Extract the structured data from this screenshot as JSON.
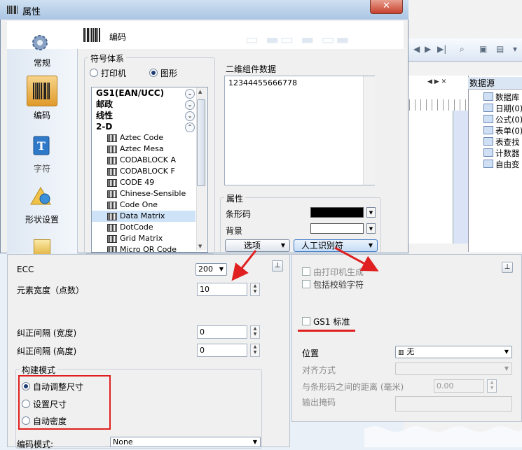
{
  "window": {
    "title": "属性",
    "close": "✕"
  },
  "category_title": "编码",
  "sidebar": [
    {
      "label": "常规",
      "icon": "gear-icon"
    },
    {
      "label": "编码",
      "icon": "barcode-icon"
    },
    {
      "label": "字符",
      "icon": "text-icon"
    },
    {
      "label": "形状设置",
      "icon": "shapes-icon"
    }
  ],
  "symbology": {
    "label": "符号体系",
    "radio_printer": "打印机",
    "radio_graphic": "图形",
    "groups": [
      "GS1(EAN/UCC)",
      "邮政",
      "线性",
      "2-D"
    ],
    "items": [
      "Aztec Code",
      "Aztec Mesa",
      "CODABLOCK A",
      "CODABLOCK F",
      "CODE 49",
      "Chinese-Sensible",
      "Code One",
      "Data Matrix",
      "DotCode",
      "Grid Matrix",
      "Micro QR Code"
    ],
    "selected": "Data Matrix"
  },
  "data2d": {
    "label": "二维组件数据",
    "value": "12344455666778"
  },
  "properties": {
    "label": "属性",
    "barcode_label": "条形码",
    "barcode_color": "#000000",
    "background_label": "背景",
    "background_color": "#ffffff",
    "options_button": "选项",
    "hri_button": "人工识别符"
  },
  "options": {
    "ecc_label": "ECC",
    "ecc_value": "200",
    "module_width_label": "元素宽度（点数）",
    "module_width_value": "10",
    "correction_width_label": "纠正间隔 (宽度)",
    "correction_width_value": "0",
    "correction_height_label": "纠正间隔 (高度)",
    "correction_height_value": "0",
    "build_mode_label": "构建模式",
    "build_modes": [
      "自动调整尺寸",
      "设置尺寸",
      "自动密度"
    ],
    "build_mode_selected": "自动调整尺寸",
    "encoding_mode_label": "编码模式:",
    "encoding_mode_value": "None"
  },
  "hri": {
    "printer_generate": "由打印机生成",
    "include_check": "包括校验字符",
    "gs1_standard": "GS1 标准",
    "position_label": "位置",
    "position_value": "无",
    "align_label": "对齐方式",
    "distance_label": "与条形码之间的距离 (毫米)",
    "distance_value": "0.00",
    "output_mask_label": "输出掩码"
  },
  "background_app": {
    "datasource_title": "数据源",
    "datasource_items": [
      "数据库",
      "日期(0)",
      "公式(0)",
      "表单(0)",
      "表查找",
      "计数器",
      "自由变"
    ]
  },
  "colors": {
    "accent_red": "#e02020",
    "selection": "#cfe3f8"
  }
}
